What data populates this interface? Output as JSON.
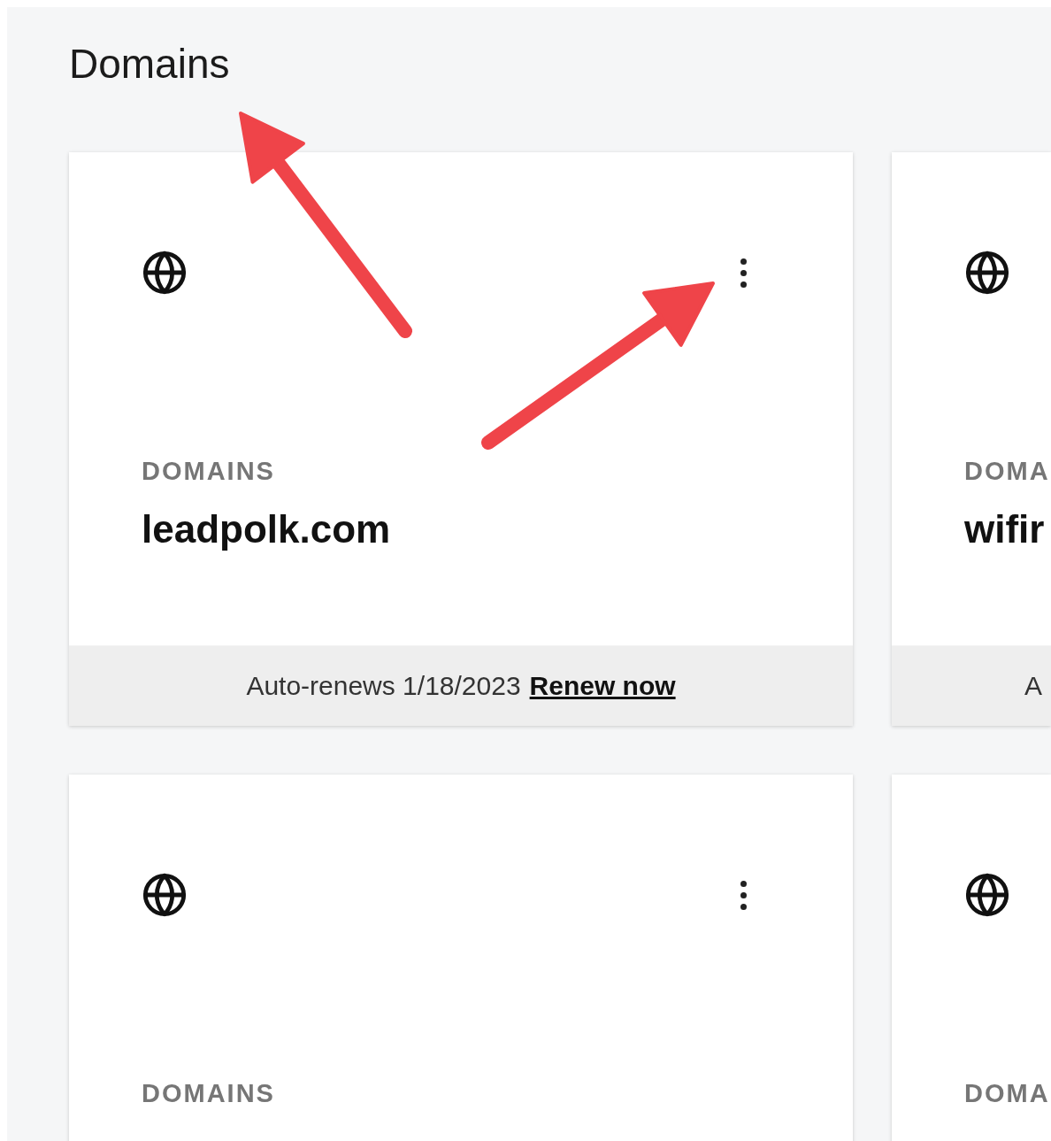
{
  "title": "Domains",
  "cards": [
    {
      "label": "DOMAINS",
      "name": "leadpolk.com",
      "footer": {
        "text": "Auto-renews 1/18/2023",
        "link": "Renew now"
      }
    },
    {
      "label": "DOMA",
      "name": "wifir",
      "footer": {
        "text": "A"
      }
    },
    {
      "label": "DOMAINS"
    },
    {
      "label": "DOMA"
    }
  ]
}
